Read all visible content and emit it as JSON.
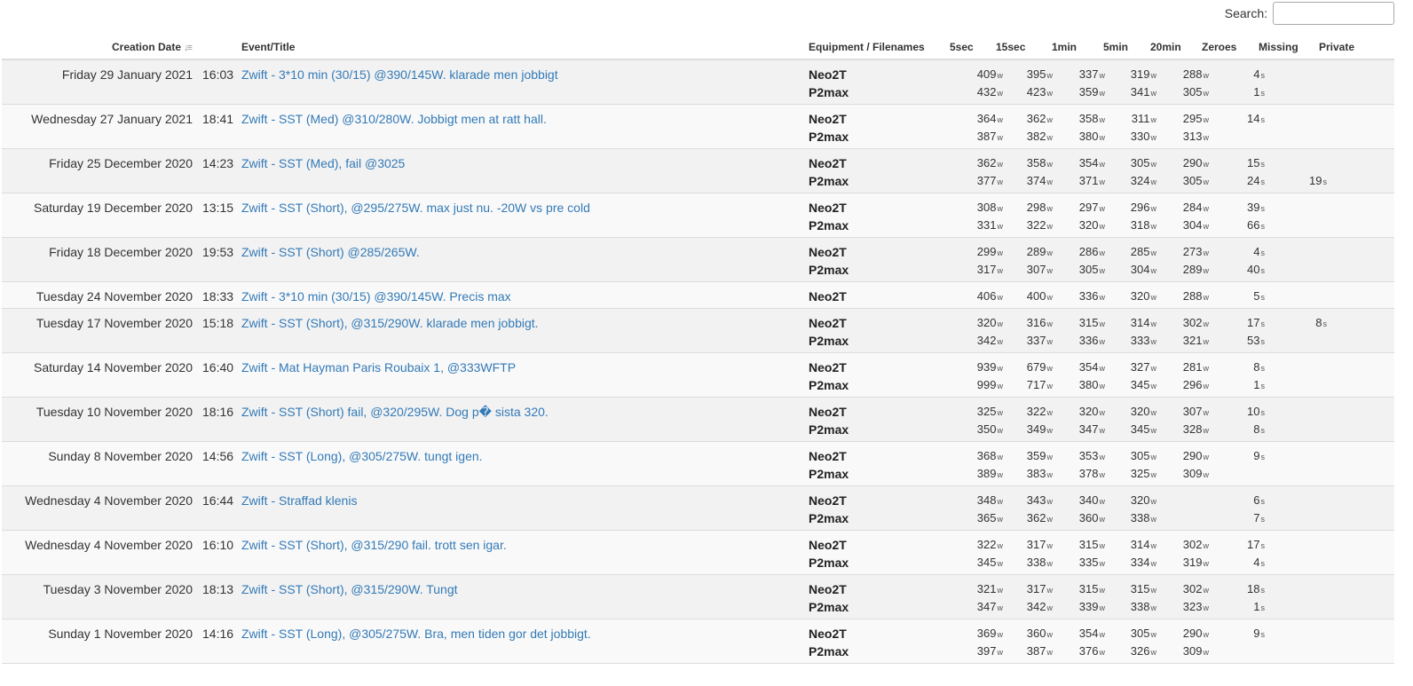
{
  "search": {
    "label": "Search:",
    "value": ""
  },
  "columns": {
    "creation_date": "Creation Date",
    "event_title": "Event/Title",
    "equipment": "Equipment / Filenames",
    "p5sec": "5sec",
    "p15sec": "15sec",
    "p1min": "1min",
    "p5min": "5min",
    "p20min": "20min",
    "zeroes": "Zeroes",
    "missing": "Missing",
    "private": "Private"
  },
  "units": {
    "power": "w",
    "seconds": "s"
  },
  "rows": [
    {
      "date": "Friday 29 January 2021",
      "time": "16:03",
      "title": "Zwift - 3*10 min (30/15) @390/145W. klarade men jobbigt",
      "devices": [
        {
          "name": "Neo2T",
          "p5sec": "409",
          "p15sec": "395",
          "p1min": "337",
          "p5min": "319",
          "p20min": "288",
          "zeroes": "4",
          "missing": ""
        },
        {
          "name": "P2max",
          "p5sec": "432",
          "p15sec": "423",
          "p1min": "359",
          "p5min": "341",
          "p20min": "305",
          "zeroes": "1",
          "missing": ""
        }
      ]
    },
    {
      "date": "Wednesday 27 January 2021",
      "time": "18:41",
      "title": "Zwift - SST (Med) @310/280W. Jobbigt men at ratt hall.",
      "devices": [
        {
          "name": "Neo2T",
          "p5sec": "364",
          "p15sec": "362",
          "p1min": "358",
          "p5min": "311",
          "p20min": "295",
          "zeroes": "14",
          "missing": ""
        },
        {
          "name": "P2max",
          "p5sec": "387",
          "p15sec": "382",
          "p1min": "380",
          "p5min": "330",
          "p20min": "313",
          "zeroes": "",
          "missing": ""
        }
      ]
    },
    {
      "date": "Friday 25 December 2020",
      "time": "14:23",
      "title": "Zwift - SST (Med), fail @3025",
      "devices": [
        {
          "name": "Neo2T",
          "p5sec": "362",
          "p15sec": "358",
          "p1min": "354",
          "p5min": "305",
          "p20min": "290",
          "zeroes": "15",
          "missing": ""
        },
        {
          "name": "P2max",
          "p5sec": "377",
          "p15sec": "374",
          "p1min": "371",
          "p5min": "324",
          "p20min": "305",
          "zeroes": "24",
          "missing": "19"
        }
      ]
    },
    {
      "date": "Saturday 19 December 2020",
      "time": "13:15",
      "title": "Zwift - SST (Short), @295/275W. max just nu. -20W vs pre cold",
      "devices": [
        {
          "name": "Neo2T",
          "p5sec": "308",
          "p15sec": "298",
          "p1min": "297",
          "p5min": "296",
          "p20min": "284",
          "zeroes": "39",
          "missing": ""
        },
        {
          "name": "P2max",
          "p5sec": "331",
          "p15sec": "322",
          "p1min": "320",
          "p5min": "318",
          "p20min": "304",
          "zeroes": "66",
          "missing": ""
        }
      ]
    },
    {
      "date": "Friday 18 December 2020",
      "time": "19:53",
      "title": "Zwift - SST (Short) @285/265W.",
      "devices": [
        {
          "name": "Neo2T",
          "p5sec": "299",
          "p15sec": "289",
          "p1min": "286",
          "p5min": "285",
          "p20min": "273",
          "zeroes": "4",
          "missing": ""
        },
        {
          "name": "P2max",
          "p5sec": "317",
          "p15sec": "307",
          "p1min": "305",
          "p5min": "304",
          "p20min": "289",
          "zeroes": "40",
          "missing": ""
        }
      ]
    },
    {
      "date": "Tuesday 24 November 2020",
      "time": "18:33",
      "title": "Zwift - 3*10 min (30/15) @390/145W. Precis max",
      "devices": [
        {
          "name": "Neo2T",
          "p5sec": "406",
          "p15sec": "400",
          "p1min": "336",
          "p5min": "320",
          "p20min": "288",
          "zeroes": "5",
          "missing": ""
        }
      ]
    },
    {
      "date": "Tuesday 17 November 2020",
      "time": "15:18",
      "title": "Zwift - SST (Short), @315/290W. klarade men jobbigt.",
      "devices": [
        {
          "name": "Neo2T",
          "p5sec": "320",
          "p15sec": "316",
          "p1min": "315",
          "p5min": "314",
          "p20min": "302",
          "zeroes": "17",
          "missing": "8"
        },
        {
          "name": "P2max",
          "p5sec": "342",
          "p15sec": "337",
          "p1min": "336",
          "p5min": "333",
          "p20min": "321",
          "zeroes": "53",
          "missing": ""
        }
      ]
    },
    {
      "date": "Saturday 14 November 2020",
      "time": "16:40",
      "title": "Zwift - Mat Hayman Paris Roubaix 1, @333WFTP",
      "devices": [
        {
          "name": "Neo2T",
          "p5sec": "939",
          "p15sec": "679",
          "p1min": "354",
          "p5min": "327",
          "p20min": "281",
          "zeroes": "8",
          "missing": ""
        },
        {
          "name": "P2max",
          "p5sec": "999",
          "p15sec": "717",
          "p1min": "380",
          "p5min": "345",
          "p20min": "296",
          "zeroes": "1",
          "missing": ""
        }
      ]
    },
    {
      "date": "Tuesday 10 November 2020",
      "time": "18:16",
      "title": "Zwift - SST (Short) fail, @320/295W. Dog p� sista 320.",
      "devices": [
        {
          "name": "Neo2T",
          "p5sec": "325",
          "p15sec": "322",
          "p1min": "320",
          "p5min": "320",
          "p20min": "307",
          "zeroes": "10",
          "missing": ""
        },
        {
          "name": "P2max",
          "p5sec": "350",
          "p15sec": "349",
          "p1min": "347",
          "p5min": "345",
          "p20min": "328",
          "zeroes": "8",
          "missing": ""
        }
      ]
    },
    {
      "date": "Sunday 8 November 2020",
      "time": "14:56",
      "title": "Zwift - SST (Long), @305/275W. tungt igen.",
      "devices": [
        {
          "name": "Neo2T",
          "p5sec": "368",
          "p15sec": "359",
          "p1min": "353",
          "p5min": "305",
          "p20min": "290",
          "zeroes": "9",
          "missing": ""
        },
        {
          "name": "P2max",
          "p5sec": "389",
          "p15sec": "383",
          "p1min": "378",
          "p5min": "325",
          "p20min": "309",
          "zeroes": "",
          "missing": ""
        }
      ]
    },
    {
      "date": "Wednesday 4 November 2020",
      "time": "16:44",
      "title": "Zwift - Straffad klenis",
      "devices": [
        {
          "name": "Neo2T",
          "p5sec": "348",
          "p15sec": "343",
          "p1min": "340",
          "p5min": "320",
          "p20min": "",
          "zeroes": "6",
          "missing": ""
        },
        {
          "name": "P2max",
          "p5sec": "365",
          "p15sec": "362",
          "p1min": "360",
          "p5min": "338",
          "p20min": "",
          "zeroes": "7",
          "missing": ""
        }
      ]
    },
    {
      "date": "Wednesday 4 November 2020",
      "time": "16:10",
      "title": "Zwift - SST (Short), @315/290 fail. trott sen igar.",
      "devices": [
        {
          "name": "Neo2T",
          "p5sec": "322",
          "p15sec": "317",
          "p1min": "315",
          "p5min": "314",
          "p20min": "302",
          "zeroes": "17",
          "missing": ""
        },
        {
          "name": "P2max",
          "p5sec": "345",
          "p15sec": "338",
          "p1min": "335",
          "p5min": "334",
          "p20min": "319",
          "zeroes": "4",
          "missing": ""
        }
      ]
    },
    {
      "date": "Tuesday 3 November 2020",
      "time": "18:13",
      "title": "Zwift - SST (Short), @315/290W. Tungt",
      "devices": [
        {
          "name": "Neo2T",
          "p5sec": "321",
          "p15sec": "317",
          "p1min": "315",
          "p5min": "315",
          "p20min": "302",
          "zeroes": "18",
          "missing": ""
        },
        {
          "name": "P2max",
          "p5sec": "347",
          "p15sec": "342",
          "p1min": "339",
          "p5min": "338",
          "p20min": "323",
          "zeroes": "1",
          "missing": ""
        }
      ]
    },
    {
      "date": "Sunday 1 November 2020",
      "time": "14:16",
      "title": "Zwift - SST (Long), @305/275W. Bra, men tiden gor det jobbigt.",
      "devices": [
        {
          "name": "Neo2T",
          "p5sec": "369",
          "p15sec": "360",
          "p1min": "354",
          "p5min": "305",
          "p20min": "290",
          "zeroes": "9",
          "missing": ""
        },
        {
          "name": "P2max",
          "p5sec": "397",
          "p15sec": "387",
          "p1min": "376",
          "p5min": "326",
          "p20min": "309",
          "zeroes": "",
          "missing": ""
        }
      ]
    }
  ]
}
